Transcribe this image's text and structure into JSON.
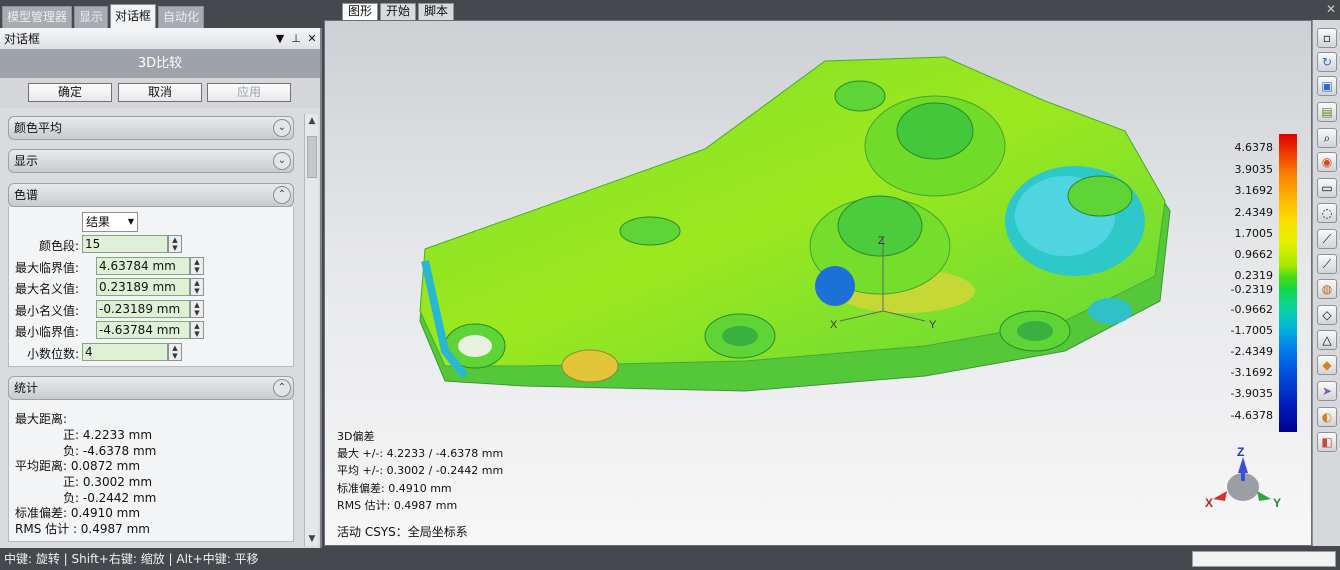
{
  "left_tabs": [
    "模型管理器",
    "显示",
    "对话框",
    "自动化"
  ],
  "panel_title": "对话框",
  "dialog_title": "3D比较",
  "buttons": {
    "ok": "确定",
    "cancel": "取消",
    "apply": "应用"
  },
  "sections": {
    "color_avg": "颜色平均",
    "display": "显示",
    "spectrum": "色谱",
    "stats": "统计"
  },
  "spectrum": {
    "dropdown": "结果",
    "fields": [
      {
        "label": "颜色段:",
        "value": "15"
      },
      {
        "label": "最大临界值:",
        "value": "4.63784 mm"
      },
      {
        "label": "最大名义值:",
        "value": "0.23189 mm"
      },
      {
        "label": "最小名义值:",
        "value": "-0.23189 mm"
      },
      {
        "label": "最小临界值:",
        "value": "-4.63784 mm"
      },
      {
        "label": "小数位数:",
        "value": "4"
      }
    ]
  },
  "stats": [
    "最大距离:",
    "正: 4.2233 mm",
    "负: -4.6378 mm",
    "平均距离: 0.0872 mm",
    "正: 0.3002 mm",
    "负: -0.2442 mm",
    "标准偏差: 0.4910 mm",
    "RMS 估计 : 0.4987 mm"
  ],
  "right_tabs": [
    "图形",
    "开始",
    "脚本"
  ],
  "legend_values": [
    "4.6378",
    "3.9035",
    "3.1692",
    "2.4349",
    "1.7005",
    "0.9662",
    "0.2319",
    "-0.2319",
    "-0.9662",
    "-1.7005",
    "-2.4349",
    "-3.1692",
    "-3.9035",
    "-4.6378"
  ],
  "overlay": {
    "title": "3D偏差",
    "max": "最大 +/-: 4.2233 / -4.6378 mm",
    "avg": "平均 +/-: 0.3002 / -0.2442 mm",
    "std": "标准偏差: 0.4910 mm",
    "rms": "RMS 估计:  0.4987 mm",
    "csys": "活动 CSYS：全局坐标系"
  },
  "axis_labels": {
    "x": "X",
    "y": "Y",
    "z": "Z"
  },
  "status_text": "中键: 旋转 | Shift+右键: 缩放 | Alt+中键: 平移"
}
